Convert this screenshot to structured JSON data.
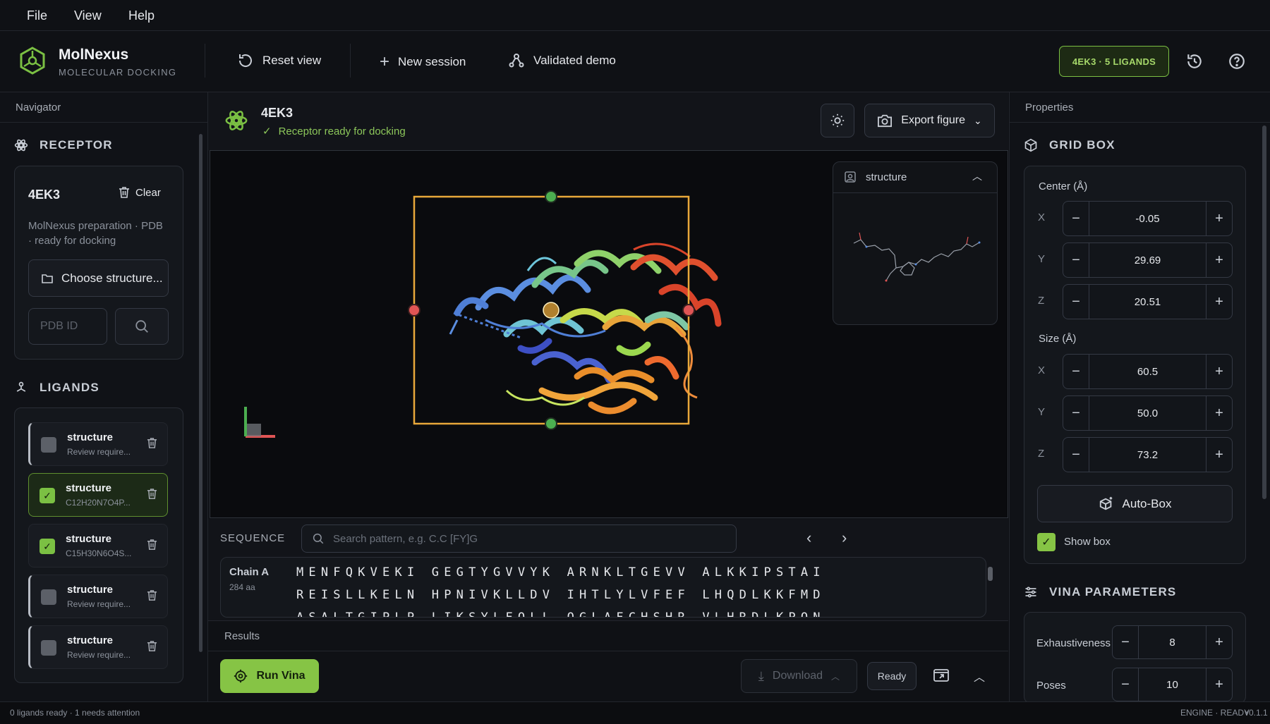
{
  "menu": {
    "file": "File",
    "view": "View",
    "help": "Help"
  },
  "brand": {
    "name": "MolNexus",
    "subtitle": "MOLECULAR DOCKING"
  },
  "toolbar": {
    "reset": "Reset view",
    "new_session": "New session",
    "demo": "Validated demo"
  },
  "header_badge": "4EK3 · 5 LIGANDS",
  "navigator": {
    "title": "Navigator",
    "receptor_section": "RECEPTOR",
    "receptor_name": "4EK3",
    "clear": "Clear",
    "receptor_desc_1": "MolNexus preparation · PDB",
    "receptor_desc_2": "· ready for docking",
    "choose": "Choose structure...",
    "pdb_placeholder": "PDB ID",
    "ligands_section": "LIGANDS",
    "ligands": [
      {
        "name": "structure",
        "sub": "Review require...",
        "checked": false,
        "state": "warn"
      },
      {
        "name": "structure",
        "sub": "C12H20N7O4P...",
        "checked": true,
        "state": "selected"
      },
      {
        "name": "structure",
        "sub": "C15H30N6O4S...",
        "checked": true,
        "state": "normal"
      },
      {
        "name": "structure",
        "sub": "Review require...",
        "checked": false,
        "state": "warn"
      },
      {
        "name": "structure",
        "sub": "Review require...",
        "checked": false,
        "state": "warn"
      }
    ]
  },
  "viewer": {
    "title": "4EK3",
    "status": "Receptor ready for docking",
    "export": "Export figure",
    "inset_title": "structure"
  },
  "sequence": {
    "label": "SEQUENCE",
    "search_placeholder": "Search pattern, e.g. C.C  [FY]G",
    "chain": "Chain A",
    "chain_len": "284 aa",
    "row1": "MENFQKVEKI GEGTYGVVYK ARNKLTGEVV ALKKIPSTAI",
    "row2": "REISLLKELN HPNIVKLLDV IHTLYLVFEF LHQDLKKFMD",
    "row3": "ASALTGIPLP LIKSYLFQLL QGLAFCHSHR VLHRDLKPQN"
  },
  "results": {
    "label": "Results",
    "run": "Run Vina",
    "download": "Download",
    "ready": "Ready"
  },
  "properties": {
    "title": "Properties",
    "grid_section": "GRID BOX",
    "center_label": "Center (Å)",
    "center": [
      {
        "axis": "X",
        "value": "-0.05"
      },
      {
        "axis": "Y",
        "value": "29.69"
      },
      {
        "axis": "Z",
        "value": "20.51"
      }
    ],
    "size_label": "Size (Å)",
    "size": [
      {
        "axis": "X",
        "value": "60.5"
      },
      {
        "axis": "Y",
        "value": "50.0"
      },
      {
        "axis": "Z",
        "value": "73.2"
      }
    ],
    "autobox": "Auto-Box",
    "show_box": "Show box",
    "vina_section": "VINA PARAMETERS",
    "exhaustiveness_label": "Exhaustiveness",
    "exhaustiveness": "8",
    "poses_label": "Poses",
    "poses": "10"
  },
  "status_bar": {
    "left": "0 ligands ready · 1 needs attention",
    "engine": "ENGINE · READY",
    "version": "v0.1.1"
  },
  "colors": {
    "accent": "#7bc043",
    "box": "#e8a83a",
    "handle_green": "#4caf50",
    "handle_red": "#e05555",
    "bg": "#0f1115"
  }
}
